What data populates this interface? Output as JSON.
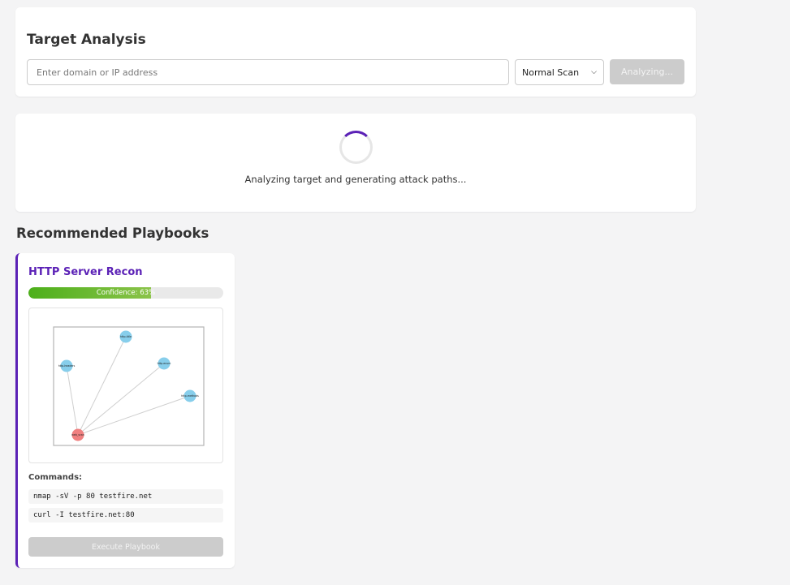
{
  "target_analysis": {
    "title": "Target Analysis",
    "input_value": "",
    "input_placeholder": "Enter domain or IP address",
    "scan_mode": "Normal Scan",
    "analyze_label": "Analyzing..."
  },
  "loading": {
    "text": "Analyzing target and generating attack paths..."
  },
  "playbooks": {
    "heading": "Recommended Playbooks",
    "items": [
      {
        "title": "HTTP Server Recon",
        "confidence_percent": 63,
        "confidence_label": "Confidence: 63%",
        "graph": {
          "nodes": [
            {
              "label": "http-title",
              "color": "#87ceeb"
            },
            {
              "label": "http-headers",
              "color": "#87ceeb"
            },
            {
              "label": "http-enum",
              "color": "#87ceeb"
            },
            {
              "label": "http-methods",
              "color": "#87ceeb"
            },
            {
              "label": "web_scan",
              "color": "#f08080"
            }
          ]
        },
        "commands_label": "Commands:",
        "commands": [
          "nmap -sV -p 80 testfire.net",
          "curl -I testfire.net:80"
        ],
        "execute_label": "Execute Playbook"
      }
    ]
  }
}
